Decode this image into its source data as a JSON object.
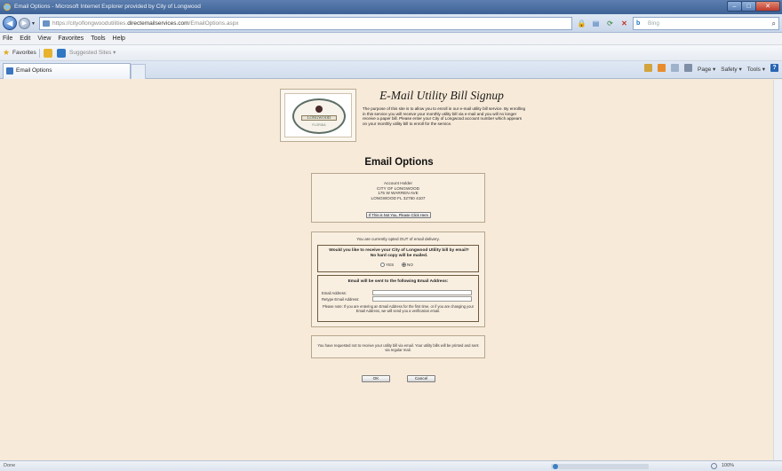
{
  "browser": {
    "window_title": "Email Options - Microsoft Internet Explorer provided by City of Longwood",
    "address": {
      "muted_prefix": "https://cityoflongwoodutilities.",
      "host": "directemailservices.com",
      "muted_suffix": "/EmailOptions.aspx"
    },
    "search_placeholder": "Bing",
    "menu": [
      "File",
      "Edit",
      "View",
      "Favorites",
      "Tools",
      "Help"
    ],
    "favorites_label": "Favorites",
    "suggested_sites_label": "Suggested Sites ▾",
    "tab_title": "Email Options",
    "command_bar": {
      "page": "Page ▾",
      "safety": "Safety ▾",
      "tools": "Tools ▾"
    },
    "status": {
      "text": "Done",
      "zoom": "100%"
    }
  },
  "header": {
    "logo": {
      "city": "LONGWOOD",
      "state": "FLORIDA"
    },
    "title": "E-Mail Utility Bill Signup",
    "description": "The purpose of this site is to allow you to enroll in our e-mail utility bill service. By enrolling in this service you will receive your monthly utility bill via e-mail and you will no longer receive a paper bill. Please enter your City of Longwood account number which appears on your monthly utility bill to enroll for the service."
  },
  "page_title": "Email Options",
  "account": {
    "label": "Account Holder",
    "name": "CITY OF LONGWOOD",
    "address": "175 W WARREN AVE",
    "city_line": "LONGWOOD FL 32750 4107",
    "not_you_button": "If This is Not You, Please Click Here"
  },
  "delivery": {
    "status": "You are currently opted OUT of email delivery.",
    "question": "Would you like to receive your City of Longwood Utility bill by email? No hard copy will be mailed.",
    "yes_label": "YES",
    "no_label": "NO",
    "selected": "NO",
    "email_heading": "Email will be sent to the following Email Address:",
    "email_label": "Email Address:",
    "reemail_label": "Retype Email Address:",
    "email_value": "",
    "reemail_value": "",
    "verify_note": "Please note: If you are entering an Email Address for the first time, or if you are changing your Email Address, we will send you a verification email."
  },
  "notice": "You have requested not to receive your utility bill via email. Your utility bills will be printed and sent via regular mail.",
  "buttons": {
    "ok": "OK",
    "cancel": "Cancel"
  },
  "colors": {
    "page_background": "#f7ead9",
    "panel_border": "#b7a68d",
    "titlebar": "#3e6296"
  },
  "icons": [
    "ie-logo-icon",
    "back-icon",
    "forward-icon",
    "lock-icon",
    "compat-view-icon",
    "refresh-icon",
    "stop-icon",
    "bing-search-icon",
    "favorites-star-icon",
    "add-favorite-icon",
    "suggested-sites-icon",
    "tab-page-icon",
    "home-icon",
    "feeds-icon",
    "mail-icon",
    "print-icon",
    "help-icon"
  ]
}
